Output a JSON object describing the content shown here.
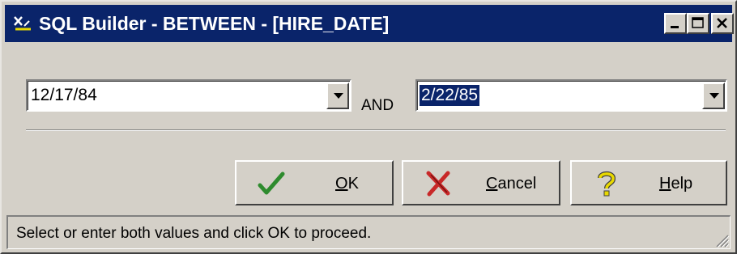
{
  "window": {
    "title": "SQL Builder - BETWEEN - [HIRE_DATE]",
    "icon": "sql-builder-icon",
    "controls": [
      "minimize-icon",
      "maximize-icon",
      "close-icon"
    ]
  },
  "range": {
    "from_value": "12/17/84",
    "and_label": "AND",
    "to_value": "2/22/85"
  },
  "buttons": {
    "ok": {
      "mnemonic": "O",
      "rest": "K",
      "icon": "checkmark-icon"
    },
    "cancel": {
      "mnemonic": "C",
      "rest": "ancel",
      "icon": "red-x-icon"
    },
    "help": {
      "mnemonic": "H",
      "rest": "elp",
      "icon": "question-mark-icon"
    }
  },
  "status": {
    "text": "Select or enter both values and click OK to proceed."
  },
  "colors": {
    "title_bar": "#0a246a",
    "face": "#d4d0c8",
    "selection": "#0a246a",
    "ok_icon": "#2e8b2e",
    "cancel_icon": "#c82828",
    "help_icon": "#e8d800"
  }
}
